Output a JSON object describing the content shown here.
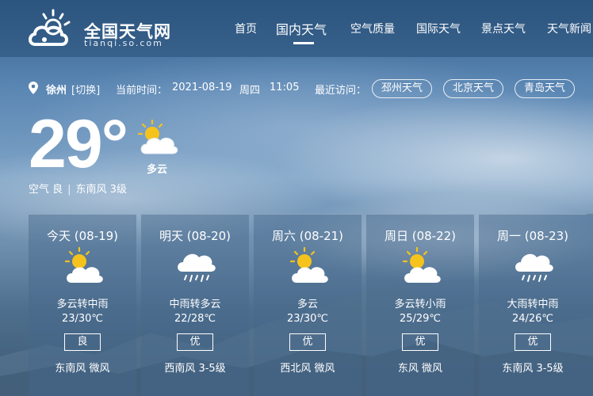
{
  "brand": {
    "title": "全国天气网",
    "domain": "tianqi.so.com"
  },
  "nav": {
    "items": [
      {
        "label": "首页"
      },
      {
        "label": "国内天气",
        "active": true
      },
      {
        "label": "空气质量"
      },
      {
        "label": "国际天气"
      },
      {
        "label": "景点天气"
      },
      {
        "label": "天气新闻"
      }
    ]
  },
  "location": {
    "city": "徐州",
    "switch_label": "[切换]",
    "time_label": "当前时间：",
    "date": "2021-08-19",
    "weekday": "周四",
    "time": "11:05",
    "recent_label": "最近访问：",
    "recent": [
      "邳州天气",
      "北京天气",
      "青岛天气"
    ]
  },
  "current": {
    "temp": "29°",
    "condition": "多云",
    "icon": "partly-cloudy-icon",
    "air": "空气 良",
    "wind": "东南风 3级"
  },
  "forecast": [
    {
      "date": "今天 (08-19)",
      "condition": "多云转中雨",
      "temp": "23/30℃",
      "aqi": "良",
      "wind": "东南风 微风",
      "icon": "partly-cloudy-icon"
    },
    {
      "date": "明天 (08-20)",
      "condition": "中雨转多云",
      "temp": "22/28℃",
      "aqi": "优",
      "wind": "西南风 3-5级",
      "icon": "rain-cloud-icon"
    },
    {
      "date": "周六 (08-21)",
      "condition": "多云",
      "temp": "23/30℃",
      "aqi": "优",
      "wind": "西北风 微风",
      "icon": "partly-cloudy-icon"
    },
    {
      "date": "周日 (08-22)",
      "condition": "多云转小雨",
      "temp": "25/29℃",
      "aqi": "优",
      "wind": "东风 微风",
      "icon": "partly-cloudy-icon"
    },
    {
      "date": "周一 (08-23)",
      "condition": "大雨转中雨",
      "temp": "24/26℃",
      "aqi": "优",
      "wind": "东南风 3-5级",
      "icon": "rain-cloud-icon"
    }
  ],
  "colors": {
    "sun": "#f6c31c",
    "cloud": "#ffffff",
    "rain": "#ffffff"
  }
}
